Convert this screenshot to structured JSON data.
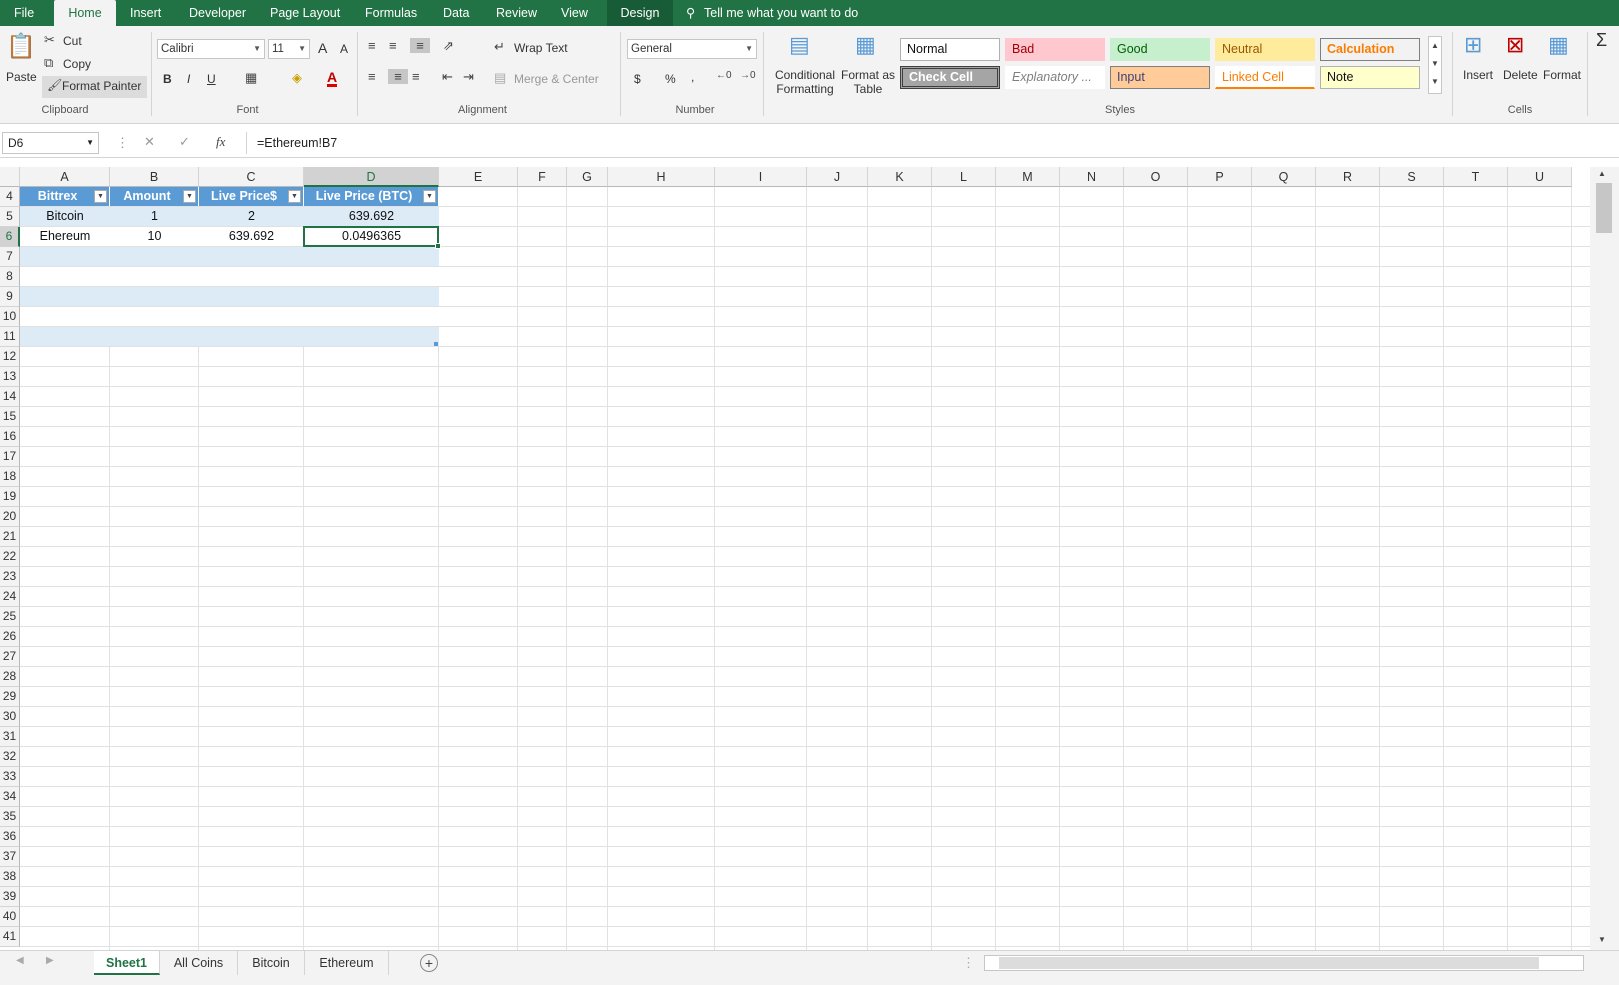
{
  "menu": {
    "tabs": [
      "File",
      "Home",
      "Insert",
      "Developer",
      "Page Layout",
      "Formulas",
      "Data",
      "Review",
      "View",
      "Design"
    ],
    "tell_me": "Tell me what you want to do"
  },
  "ribbon": {
    "clipboard": {
      "paste": "Paste",
      "cut": "Cut",
      "copy": "Copy",
      "format_painter": "Format Painter",
      "label": "Clipboard"
    },
    "font": {
      "name": "Calibri",
      "size": "11",
      "label": "Font",
      "bold": "B",
      "italic": "I",
      "underline": "U",
      "grow": "A",
      "shrink": "A",
      "color": "A"
    },
    "alignment": {
      "wrap": "Wrap Text",
      "merge": "Merge & Center",
      "label": "Alignment"
    },
    "number": {
      "format": "General",
      "currency": "$",
      "percent": "%",
      "comma": ",",
      "label": "Number"
    },
    "styles": {
      "conditional": [
        "Conditional",
        "Formatting"
      ],
      "format_table": [
        "Format as",
        "Table"
      ],
      "label": "Styles",
      "cells": [
        "Normal",
        "Bad",
        "Good",
        "Neutral",
        "Calculation",
        "Check Cell",
        "Explanatory ...",
        "Input",
        "Linked Cell",
        "Note"
      ]
    },
    "cells_group": {
      "insert": "Insert",
      "delete": "Delete",
      "format": "Format",
      "label": "Cells"
    },
    "editing": {
      "sum": "Σ"
    }
  },
  "formula_bar": {
    "name_box": "D6",
    "fx": "fx",
    "formula": "=Ethereum!B7"
  },
  "columns": [
    "A",
    "B",
    "C",
    "D",
    "E",
    "F",
    "G",
    "H",
    "I",
    "J",
    "K",
    "L",
    "M",
    "N",
    "O",
    "P",
    "Q",
    "R",
    "S",
    "T",
    "U"
  ],
  "rows": [
    "4",
    "5",
    "6",
    "7",
    "8",
    "9",
    "10",
    "11",
    "12",
    "13",
    "14",
    "15",
    "16",
    "17",
    "18",
    "19",
    "20",
    "21",
    "22",
    "23",
    "24",
    "25",
    "26",
    "27",
    "28",
    "29",
    "30",
    "31",
    "32",
    "33",
    "34",
    "35",
    "36",
    "37",
    "38",
    "39",
    "40",
    "41"
  ],
  "table": {
    "headers": [
      "Bittrex",
      "Amount",
      "Live Price$",
      "Live Price (BTC)"
    ],
    "rows": [
      [
        "Bitcoin",
        "1",
        "2",
        "639.692"
      ],
      [
        "Ehereum",
        "10",
        "639.692",
        "0.0496365"
      ]
    ]
  },
  "sheets": {
    "tabs": [
      "Sheet1",
      "All Coins",
      "Bitcoin",
      "Ethereum"
    ],
    "active": "Sheet1",
    "add": "+"
  },
  "colors": {
    "accent": "#217346",
    "table_header": "#5b9bd5",
    "table_band": "#ddebf7"
  }
}
